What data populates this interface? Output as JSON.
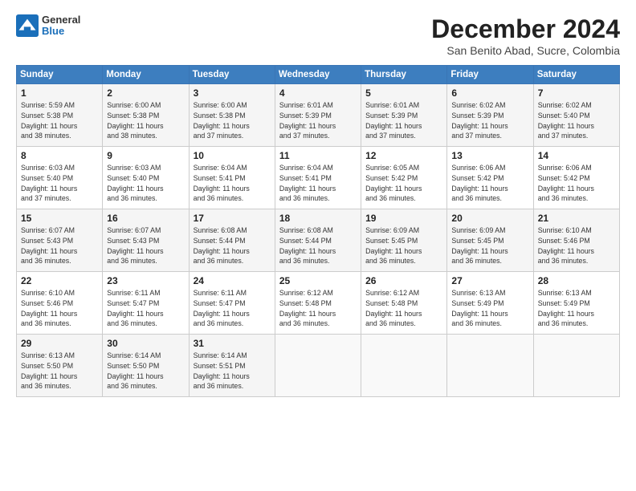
{
  "logo": {
    "general": "General",
    "blue": "Blue"
  },
  "header": {
    "month": "December 2024",
    "location": "San Benito Abad, Sucre, Colombia"
  },
  "days_of_week": [
    "Sunday",
    "Monday",
    "Tuesday",
    "Wednesday",
    "Thursday",
    "Friday",
    "Saturday"
  ],
  "weeks": [
    [
      {
        "day": "1",
        "info": "Sunrise: 5:59 AM\nSunset: 5:38 PM\nDaylight: 11 hours\nand 38 minutes."
      },
      {
        "day": "2",
        "info": "Sunrise: 6:00 AM\nSunset: 5:38 PM\nDaylight: 11 hours\nand 38 minutes."
      },
      {
        "day": "3",
        "info": "Sunrise: 6:00 AM\nSunset: 5:38 PM\nDaylight: 11 hours\nand 37 minutes."
      },
      {
        "day": "4",
        "info": "Sunrise: 6:01 AM\nSunset: 5:39 PM\nDaylight: 11 hours\nand 37 minutes."
      },
      {
        "day": "5",
        "info": "Sunrise: 6:01 AM\nSunset: 5:39 PM\nDaylight: 11 hours\nand 37 minutes."
      },
      {
        "day": "6",
        "info": "Sunrise: 6:02 AM\nSunset: 5:39 PM\nDaylight: 11 hours\nand 37 minutes."
      },
      {
        "day": "7",
        "info": "Sunrise: 6:02 AM\nSunset: 5:40 PM\nDaylight: 11 hours\nand 37 minutes."
      }
    ],
    [
      {
        "day": "8",
        "info": "Sunrise: 6:03 AM\nSunset: 5:40 PM\nDaylight: 11 hours\nand 37 minutes."
      },
      {
        "day": "9",
        "info": "Sunrise: 6:03 AM\nSunset: 5:40 PM\nDaylight: 11 hours\nand 36 minutes."
      },
      {
        "day": "10",
        "info": "Sunrise: 6:04 AM\nSunset: 5:41 PM\nDaylight: 11 hours\nand 36 minutes."
      },
      {
        "day": "11",
        "info": "Sunrise: 6:04 AM\nSunset: 5:41 PM\nDaylight: 11 hours\nand 36 minutes."
      },
      {
        "day": "12",
        "info": "Sunrise: 6:05 AM\nSunset: 5:42 PM\nDaylight: 11 hours\nand 36 minutes."
      },
      {
        "day": "13",
        "info": "Sunrise: 6:06 AM\nSunset: 5:42 PM\nDaylight: 11 hours\nand 36 minutes."
      },
      {
        "day": "14",
        "info": "Sunrise: 6:06 AM\nSunset: 5:42 PM\nDaylight: 11 hours\nand 36 minutes."
      }
    ],
    [
      {
        "day": "15",
        "info": "Sunrise: 6:07 AM\nSunset: 5:43 PM\nDaylight: 11 hours\nand 36 minutes."
      },
      {
        "day": "16",
        "info": "Sunrise: 6:07 AM\nSunset: 5:43 PM\nDaylight: 11 hours\nand 36 minutes."
      },
      {
        "day": "17",
        "info": "Sunrise: 6:08 AM\nSunset: 5:44 PM\nDaylight: 11 hours\nand 36 minutes."
      },
      {
        "day": "18",
        "info": "Sunrise: 6:08 AM\nSunset: 5:44 PM\nDaylight: 11 hours\nand 36 minutes."
      },
      {
        "day": "19",
        "info": "Sunrise: 6:09 AM\nSunset: 5:45 PM\nDaylight: 11 hours\nand 36 minutes."
      },
      {
        "day": "20",
        "info": "Sunrise: 6:09 AM\nSunset: 5:45 PM\nDaylight: 11 hours\nand 36 minutes."
      },
      {
        "day": "21",
        "info": "Sunrise: 6:10 AM\nSunset: 5:46 PM\nDaylight: 11 hours\nand 36 minutes."
      }
    ],
    [
      {
        "day": "22",
        "info": "Sunrise: 6:10 AM\nSunset: 5:46 PM\nDaylight: 11 hours\nand 36 minutes."
      },
      {
        "day": "23",
        "info": "Sunrise: 6:11 AM\nSunset: 5:47 PM\nDaylight: 11 hours\nand 36 minutes."
      },
      {
        "day": "24",
        "info": "Sunrise: 6:11 AM\nSunset: 5:47 PM\nDaylight: 11 hours\nand 36 minutes."
      },
      {
        "day": "25",
        "info": "Sunrise: 6:12 AM\nSunset: 5:48 PM\nDaylight: 11 hours\nand 36 minutes."
      },
      {
        "day": "26",
        "info": "Sunrise: 6:12 AM\nSunset: 5:48 PM\nDaylight: 11 hours\nand 36 minutes."
      },
      {
        "day": "27",
        "info": "Sunrise: 6:13 AM\nSunset: 5:49 PM\nDaylight: 11 hours\nand 36 minutes."
      },
      {
        "day": "28",
        "info": "Sunrise: 6:13 AM\nSunset: 5:49 PM\nDaylight: 11 hours\nand 36 minutes."
      }
    ],
    [
      {
        "day": "29",
        "info": "Sunrise: 6:13 AM\nSunset: 5:50 PM\nDaylight: 11 hours\nand 36 minutes."
      },
      {
        "day": "30",
        "info": "Sunrise: 6:14 AM\nSunset: 5:50 PM\nDaylight: 11 hours\nand 36 minutes."
      },
      {
        "day": "31",
        "info": "Sunrise: 6:14 AM\nSunset: 5:51 PM\nDaylight: 11 hours\nand 36 minutes."
      },
      {
        "day": "",
        "info": ""
      },
      {
        "day": "",
        "info": ""
      },
      {
        "day": "",
        "info": ""
      },
      {
        "day": "",
        "info": ""
      }
    ]
  ]
}
